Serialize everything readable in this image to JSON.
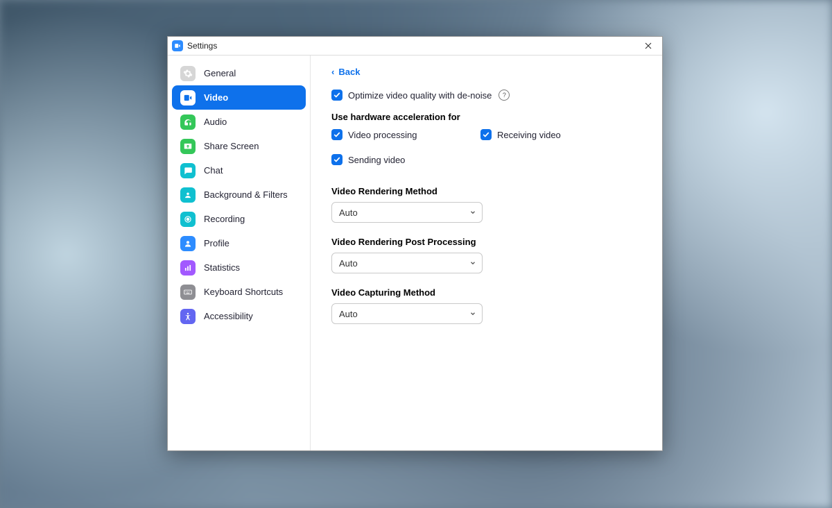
{
  "window": {
    "title": "Settings"
  },
  "sidebar": {
    "items": [
      {
        "key": "general",
        "label": "General",
        "icon": "gear",
        "bg": "#d6d6d6",
        "fg": "#ffffff"
      },
      {
        "key": "video",
        "label": "Video",
        "icon": "video",
        "bg": "#ffffff",
        "fg": "#0E71EB"
      },
      {
        "key": "audio",
        "label": "Audio",
        "icon": "audio",
        "bg": "#34c759",
        "fg": "#ffffff"
      },
      {
        "key": "share",
        "label": "Share Screen",
        "icon": "share",
        "bg": "#34c759",
        "fg": "#ffffff"
      },
      {
        "key": "chat",
        "label": "Chat",
        "icon": "chat",
        "bg": "#10c0d0",
        "fg": "#ffffff"
      },
      {
        "key": "bg",
        "label": "Background & Filters",
        "icon": "person",
        "bg": "#10c0d0",
        "fg": "#ffffff"
      },
      {
        "key": "recording",
        "label": "Recording",
        "icon": "record",
        "bg": "#10c0d0",
        "fg": "#ffffff"
      },
      {
        "key": "profile",
        "label": "Profile",
        "icon": "profile",
        "bg": "#2D8CFF",
        "fg": "#ffffff"
      },
      {
        "key": "stats",
        "label": "Statistics",
        "icon": "stats",
        "bg": "#a259ff",
        "fg": "#ffffff"
      },
      {
        "key": "keyboard",
        "label": "Keyboard Shortcuts",
        "icon": "keyboard",
        "bg": "#8e8e93",
        "fg": "#ffffff"
      },
      {
        "key": "access",
        "label": "Accessibility",
        "icon": "access",
        "bg": "#6366f1",
        "fg": "#ffffff"
      }
    ],
    "active": "video"
  },
  "content": {
    "back_label": "Back",
    "optimize_label": "Optimize video quality with de-noise",
    "hw_heading": "Use hardware acceleration for",
    "hw_options": {
      "video_processing": "Video processing",
      "receiving_video": "Receiving video",
      "sending_video": "Sending video"
    },
    "render_method": {
      "label": "Video Rendering Method",
      "value": "Auto"
    },
    "post_processing": {
      "label": "Video Rendering Post Processing",
      "value": "Auto"
    },
    "capturing_method": {
      "label": "Video Capturing Method",
      "value": "Auto"
    }
  }
}
